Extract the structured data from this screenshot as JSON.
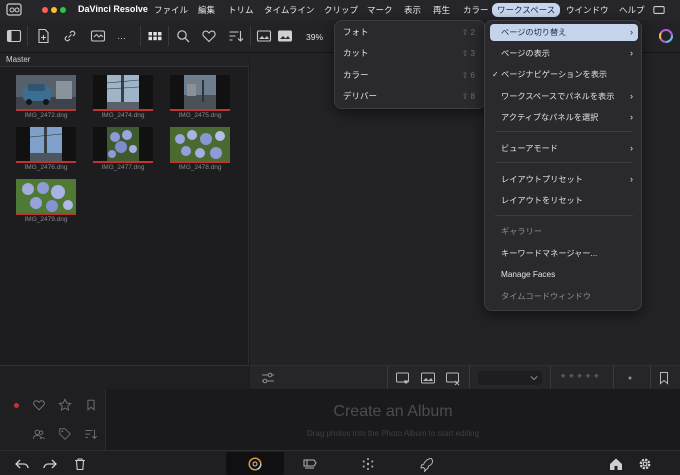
{
  "app": {
    "name": "DaVinci Resolve",
    "menus": [
      "ファイル",
      "編集",
      "トリム",
      "タイムライン",
      "クリップ",
      "マーク",
      "表示",
      "再生",
      "カラー",
      "ワークスペース",
      "ウインドウ",
      "ヘルプ"
    ],
    "active_menu": "ワークスペース"
  },
  "toolbar": {
    "more_label": "…",
    "zoom": "39%"
  },
  "media_pool": {
    "title": "Master",
    "clips": [
      {
        "name": "IMG_2472.dng",
        "scene": "car"
      },
      {
        "name": "IMG_2474.dng",
        "scene": "pole"
      },
      {
        "name": "IMG_2475.dng",
        "scene": "street"
      },
      {
        "name": "IMG_2476.dng",
        "scene": "pole-blue"
      },
      {
        "name": "IMG_2477.dng",
        "scene": "hydrangea"
      },
      {
        "name": "IMG_2478.dng",
        "scene": "hydrangea-wide"
      },
      {
        "name": "IMG_2479.dng",
        "scene": "hydrangea-close"
      }
    ]
  },
  "page_submenu": {
    "items": [
      {
        "label": "フォト",
        "shortcut": "⇧ 2"
      },
      {
        "label": "カット",
        "shortcut": "⇧ 3"
      },
      {
        "label": "カラー",
        "shortcut": "⇧ 6"
      },
      {
        "label": "デリバー",
        "shortcut": "⇧ 8"
      }
    ]
  },
  "workspace_menu": {
    "items": [
      {
        "label": "ページの切り替え",
        "submenu": true,
        "highlighted": true
      },
      {
        "label": "ページの表示",
        "submenu": true
      },
      {
        "label": "ページナビゲーションを表示",
        "checked": true
      },
      {
        "label": "ワークスペースでパネルを表示",
        "submenu": true
      },
      {
        "label": "アクティブなパネルを選択",
        "submenu": true
      },
      {
        "label": "ビューアモード",
        "submenu": true
      },
      {
        "label": "レイアウトプリセット",
        "submenu": true
      },
      {
        "label": "レイアウトをリセット"
      },
      {
        "label": "ギャラリー",
        "disabled": true
      },
      {
        "label": "キーワードマネージャー..."
      },
      {
        "label": "Manage Faces"
      },
      {
        "label": "タイムコードウィンドウ",
        "disabled": true
      }
    ]
  },
  "album": {
    "title": "Create an Album",
    "hint": "Drag photos into the Photo Album to start editing"
  },
  "colors": {
    "accent_red": "#c23333",
    "menu_highlight": "#c5d4ea",
    "background": "#1c1c1f"
  },
  "icons": [
    "panel-toggle-icon",
    "import-icon",
    "link-icon",
    "more-icon",
    "grid-view-icon",
    "search-icon",
    "heart-icon",
    "sort-icon",
    "image-icon",
    "image-frame-icon",
    "color-wheel-icon",
    "undo-icon",
    "redo-icon",
    "trash-icon",
    "photo-page-icon",
    "cut-page-icon",
    "color-page-icon",
    "deliver-page-icon",
    "home-icon",
    "settings-icon"
  ]
}
